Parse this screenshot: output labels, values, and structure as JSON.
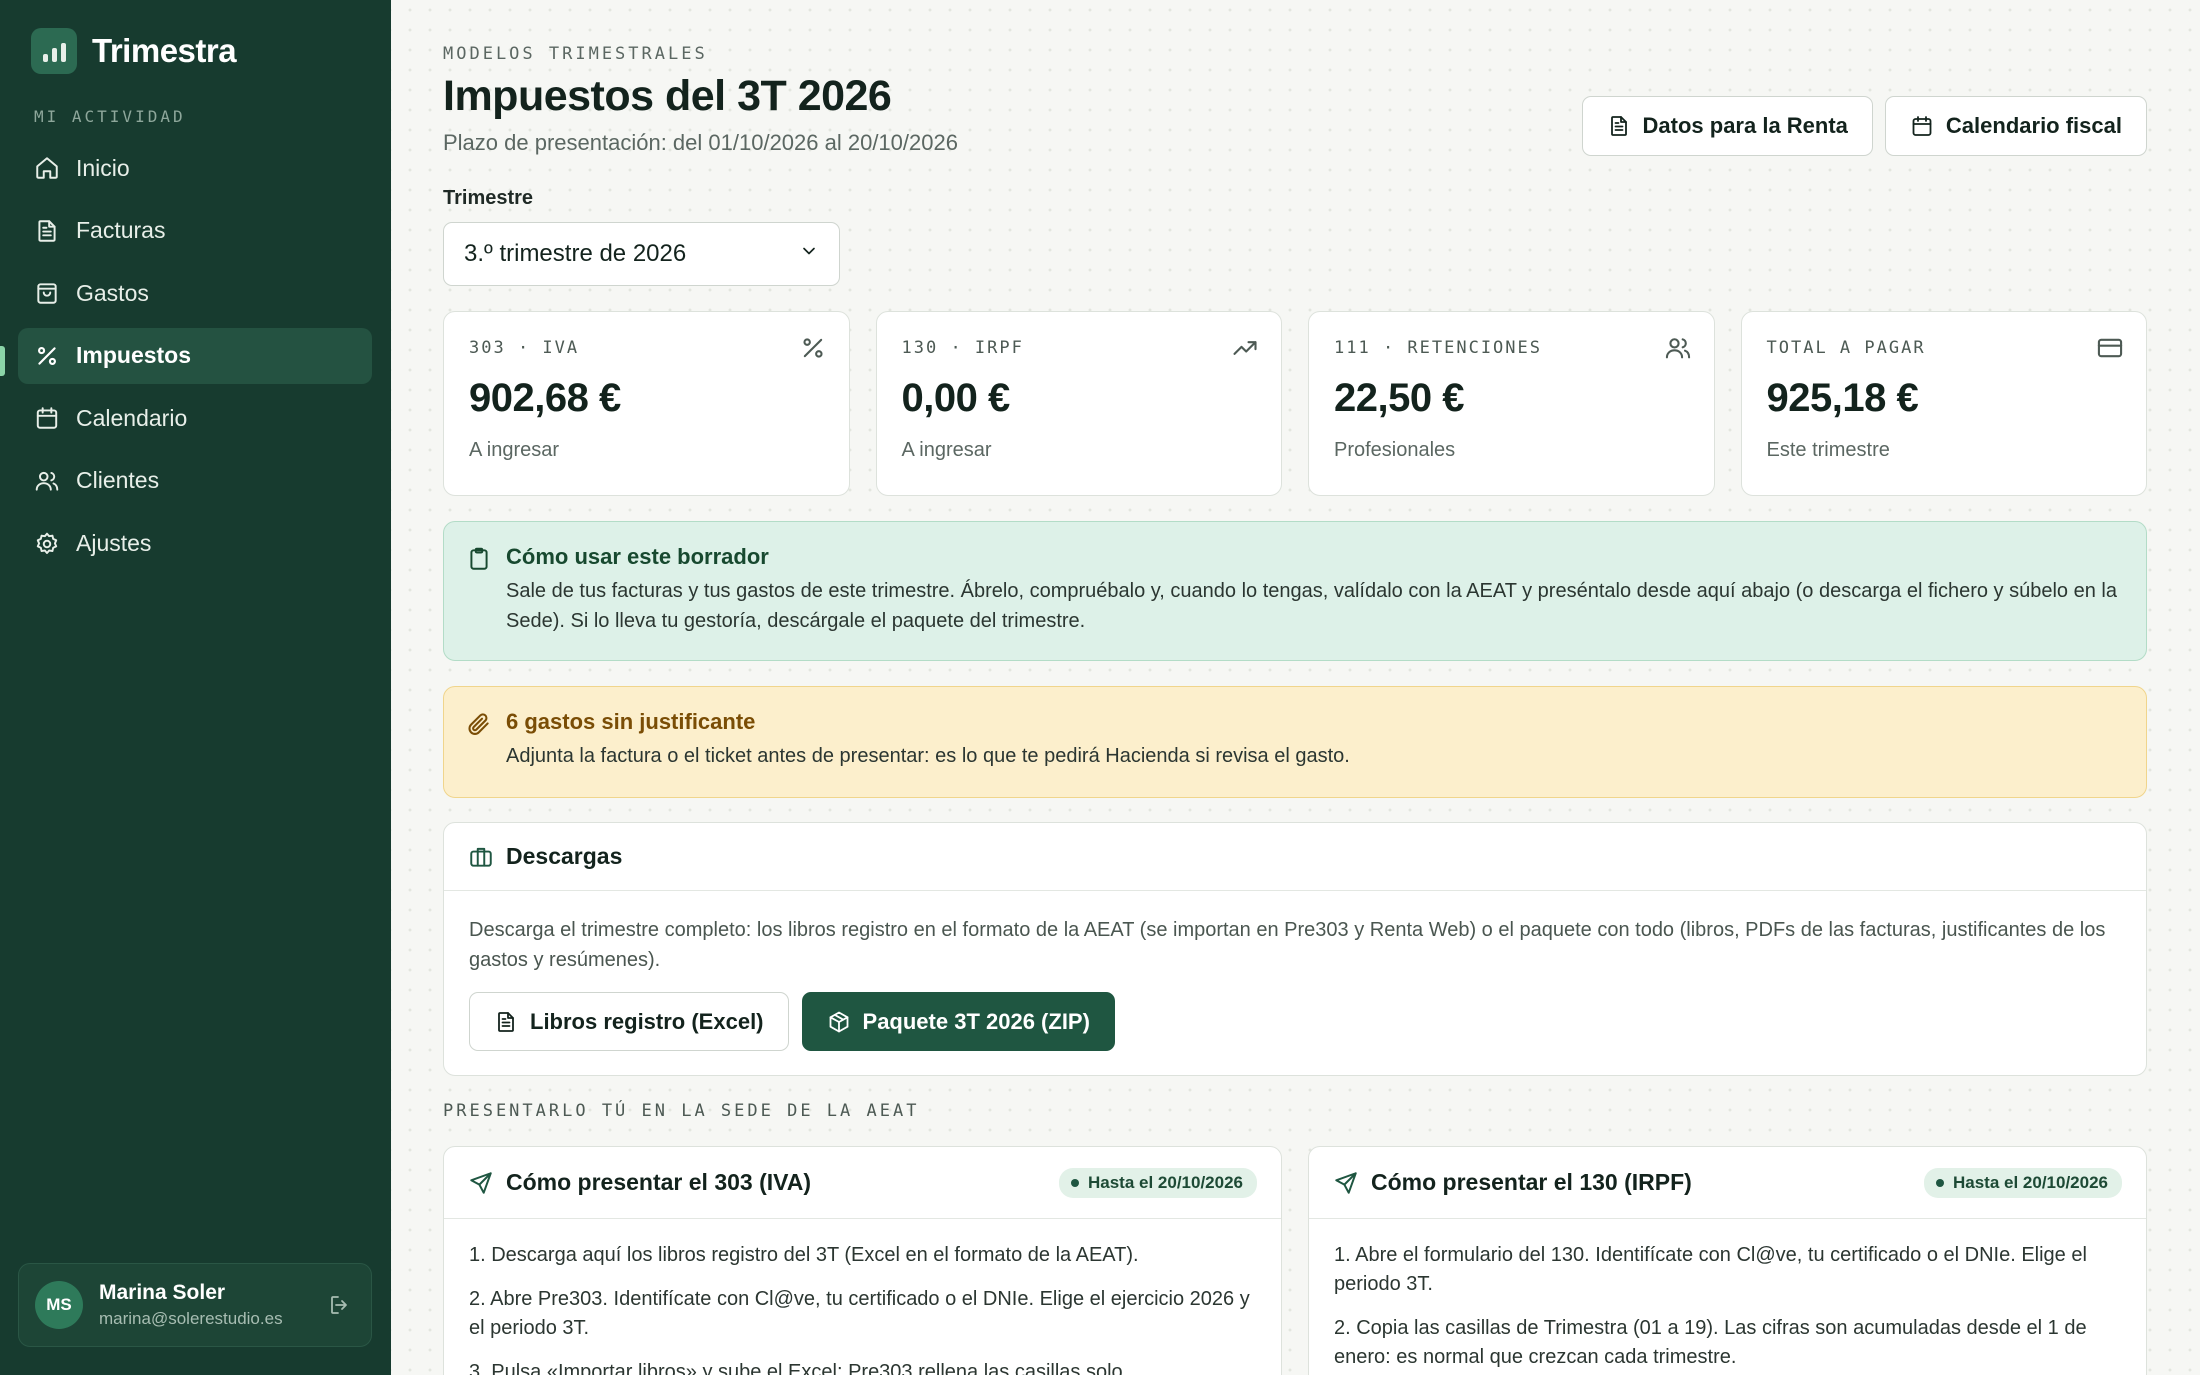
{
  "app": {
    "name": "Trimestra"
  },
  "sidebar": {
    "section_label": "MI ACTIVIDAD",
    "items": [
      {
        "label": "Inicio",
        "icon": "home-icon"
      },
      {
        "label": "Facturas",
        "icon": "file-text-icon"
      },
      {
        "label": "Gastos",
        "icon": "shopping-bag-icon"
      },
      {
        "label": "Impuestos",
        "icon": "percent-icon",
        "active": true
      },
      {
        "label": "Calendario",
        "icon": "calendar-icon"
      },
      {
        "label": "Clientes",
        "icon": "users-icon"
      },
      {
        "label": "Ajustes",
        "icon": "settings-icon"
      }
    ],
    "user": {
      "initials": "MS",
      "name": "Marina Soler",
      "email": "marina@solerestudio.es"
    }
  },
  "header": {
    "eyebrow": "MODELOS TRIMESTRALES",
    "title": "Impuestos del 3T 2026",
    "subtitle": "Plazo de presentación: del 01/10/2026 al 20/10/2026",
    "actions": {
      "renta": "Datos para la Renta",
      "calendar": "Calendario fiscal"
    }
  },
  "quarter": {
    "label": "Trimestre",
    "value": "3.º trimestre de 2026"
  },
  "stats": [
    {
      "label": "303 · IVA",
      "value": "902,68 €",
      "note": "A ingresar",
      "icon": "percent-icon"
    },
    {
      "label": "130 · IRPF",
      "value": "0,00 €",
      "note": "A ingresar",
      "icon": "trending-up-icon"
    },
    {
      "label": "111 · RETENCIONES",
      "value": "22,50 €",
      "note": "Profesionales",
      "icon": "users-icon"
    },
    {
      "label": "TOTAL A PAGAR",
      "value": "925,18 €",
      "note": "Este trimestre",
      "icon": "credit-card-icon"
    }
  ],
  "info_alert": {
    "title": "Cómo usar este borrador",
    "body": "Sale de tus facturas y tus gastos de este trimestre. Ábrelo, compruébalo y, cuando lo tengas, valídalo con la AEAT y preséntalo desde aquí abajo (o descarga el fichero y súbelo en la Sede). Si lo lleva tu gestoría, descárgale el paquete del trimestre."
  },
  "warn_alert": {
    "title": "6 gastos sin justificante",
    "body": "Adjunta la factura o el ticket antes de presentar: es lo que te pedirá Hacienda si revisa el gasto."
  },
  "downloads": {
    "title": "Descargas",
    "body": "Descarga el trimestre completo: los libros registro en el formato de la AEAT (se importan en Pre303 y Renta Web) o el paquete con todo (libros, PDFs de las facturas, justificantes de los gastos y resúmenes).",
    "excel": "Libros registro (Excel)",
    "zip": "Paquete 3T 2026 (ZIP)"
  },
  "present_section": "PRESENTARLO TÚ EN LA SEDE DE LA AEAT",
  "howto_303": {
    "title": "Cómo presentar el 303 (IVA)",
    "deadline": "Hasta el 20/10/2026",
    "steps": [
      "1. Descarga aquí los libros registro del 3T (Excel en el formato de la AEAT).",
      "2. Abre Pre303. Identifícate con Cl@ve, tu certificado o el DNIe. Elige el ejercicio 2026 y el periodo 3T.",
      "3. Pulsa «Importar libros» y sube el Excel: Pre303 rellena las casillas solo."
    ]
  },
  "howto_130": {
    "title": "Cómo presentar el 130 (IRPF)",
    "deadline": "Hasta el 20/10/2026",
    "steps": [
      "1. Abre el formulario del 130. Identifícate con Cl@ve, tu certificado o el DNIe. Elige el periodo 3T.",
      "2. Copia las casillas de Trimestra (01 a 19). Las cifras son acumuladas desde el 1 de enero: es normal que crezcan cada trimestre."
    ]
  },
  "colors": {
    "sidebar": "#173b2f",
    "accent": "#1f5641",
    "info_bg": "#ddf1e8",
    "warn_bg": "#fcefcc"
  }
}
